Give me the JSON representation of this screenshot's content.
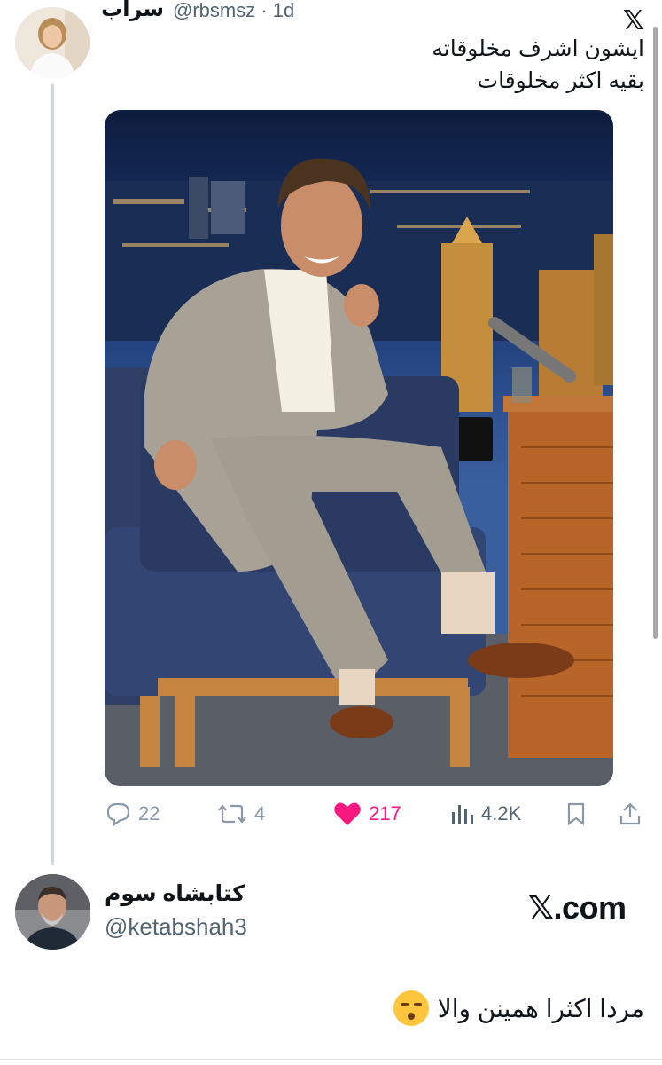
{
  "tweet1": {
    "author_name": "سراب",
    "handle_time": "@rbsmsz · 1d",
    "text_line1": "ايشون اشرف مخلوقاته",
    "text_line2": "بقيه اكثر مخلوقات",
    "actions": {
      "replies": "22",
      "retweets": "4",
      "likes": "217",
      "views": "4.2K"
    },
    "icons": [
      "x-logo-icon",
      "reply-icon",
      "retweet-icon",
      "heart-icon",
      "views-icon",
      "bookmark-icon",
      "share-icon"
    ]
  },
  "tweet2": {
    "author_name": "كتابشاه سوم",
    "handle": "@ketabshah3",
    "logo_text": "𝕏.com",
    "text": "مردا اكثرا همينن والا"
  },
  "colors": {
    "like": "#f91880",
    "muted": "#536471",
    "thread_line": "#cfd9de"
  }
}
